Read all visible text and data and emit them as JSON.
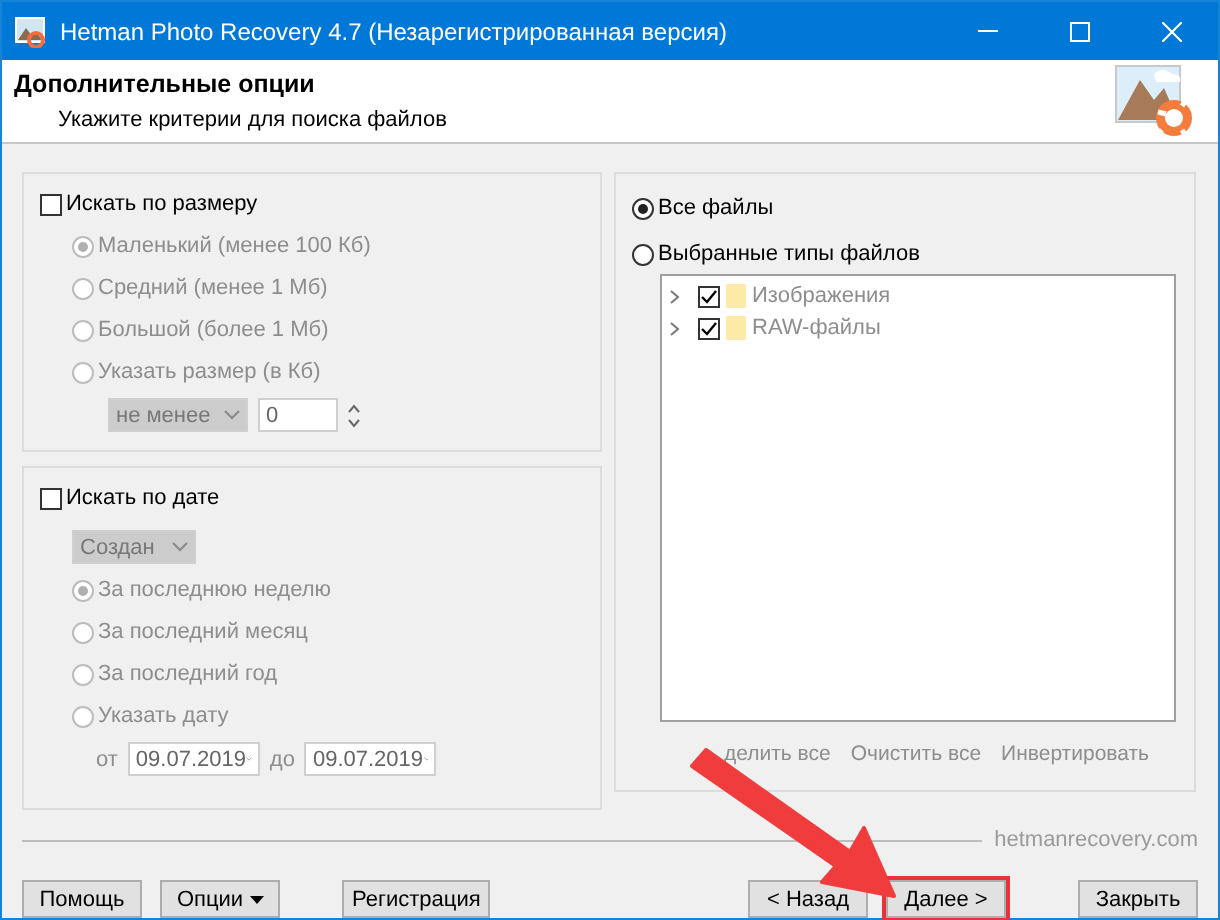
{
  "window": {
    "title": "Hetman Photo Recovery 4.7 (Незарегистрированная версия)"
  },
  "header": {
    "title": "Дополнительные опции",
    "subtitle": "Укажите критерии для поиска файлов"
  },
  "size_filter": {
    "label": "Искать по размеру",
    "checked": false,
    "options": [
      {
        "label": "Маленький (менее 100 Кб)",
        "selected": true
      },
      {
        "label": "Средний (менее 1 Мб)",
        "selected": false
      },
      {
        "label": "Большой (более 1 Мб)",
        "selected": false
      },
      {
        "label": "Указать размер (в Кб)",
        "selected": false
      }
    ],
    "comparison": "не менее",
    "value": "0"
  },
  "date_filter": {
    "label": "Искать по дате",
    "checked": false,
    "date_type": "Создан",
    "options": [
      {
        "label": "За последнюю неделю",
        "selected": true
      },
      {
        "label": "За последний месяц",
        "selected": false
      },
      {
        "label": "За последний год",
        "selected": false
      },
      {
        "label": "Указать дату",
        "selected": false
      }
    ],
    "from_label": "от",
    "from": "09.07.2019",
    "to_label": "до",
    "to": "09.07.2019"
  },
  "file_types": {
    "options": [
      {
        "label": "Все файлы",
        "selected": true
      },
      {
        "label": "Выбранные типы файлов",
        "selected": false
      }
    ],
    "tree": [
      {
        "label": "Изображения",
        "checked": true
      },
      {
        "label": "RAW-файлы",
        "checked": true
      }
    ],
    "actions": [
      "делить все",
      "Очистить все",
      "Инвертировать"
    ]
  },
  "footer": {
    "site": "hetmanrecovery.com",
    "buttons": [
      {
        "label": "Помощь",
        "kind": "plain",
        "highlighted": false
      },
      {
        "label": "Опции",
        "kind": "menu",
        "highlighted": false
      },
      {
        "label": "Регистрация",
        "kind": "plain",
        "highlighted": false
      },
      {
        "label": "< Назад",
        "kind": "plain",
        "highlighted": false
      },
      {
        "label": "Далее >",
        "kind": "plain",
        "highlighted": true
      },
      {
        "label": "Закрыть",
        "kind": "plain",
        "highlighted": false
      }
    ]
  },
  "annotations": [
    {
      "kind": "arrow"
    }
  ]
}
